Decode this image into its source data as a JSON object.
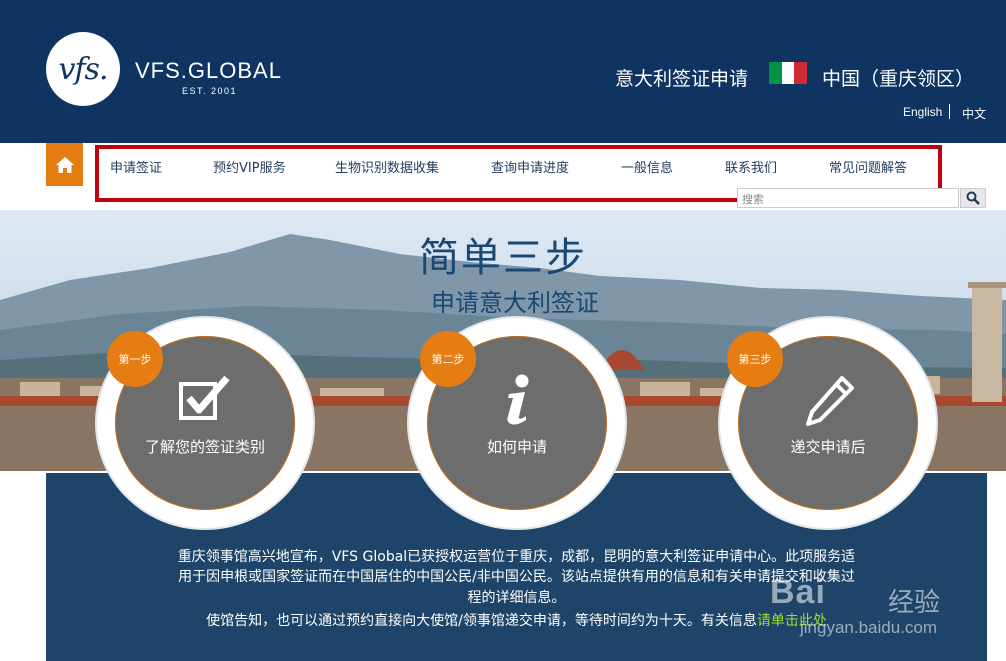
{
  "header": {
    "logo_mark": "vfs.",
    "brand_name": "VFS.GLOBAL",
    "brand_est": "EST. 2001",
    "title": "意大利签证申请",
    "region": "中国（重庆领区）",
    "flag_colors": [
      "#009246",
      "#ffffff",
      "#ce2b37"
    ],
    "lang_english": "English",
    "lang_chinese": "中文"
  },
  "nav": {
    "home_icon": "home-icon",
    "items": [
      {
        "label": "申请签证"
      },
      {
        "label": "预约VIP服务"
      },
      {
        "label": "生物识别数据收集"
      },
      {
        "label": "查询申请进度"
      },
      {
        "label": "一般信息"
      },
      {
        "label": "联系我们"
      },
      {
        "label": "常见问题解答"
      }
    ]
  },
  "search": {
    "placeholder": "搜索"
  },
  "hero": {
    "title": "简单三步",
    "subtitle": "申请意大利签证"
  },
  "steps": [
    {
      "badge": "第一步",
      "label": "了解您的签证类别",
      "icon": "checkbox-icon"
    },
    {
      "badge": "第二步",
      "label": "如何申请",
      "icon": "info-icon"
    },
    {
      "badge": "第三步",
      "label": "递交申请后",
      "icon": "pencil-icon"
    }
  ],
  "info": {
    "line1": "重庆领事馆高兴地宣布，VFS Global已获授权运营位于重庆，成都，昆明的意大利签证申请中心。此项服务适",
    "line2": "用于因申根或国家签证而在中国居住的中国公民/非中国公民。该站点提供有用的信息和有关申请提交和收集过",
    "line3": "程的详细信息。",
    "line4": "使馆告知，也可以通过预约直接向大使馆/领事馆递交申请，等待时间约为十天。有关信息",
    "link": "请单击此处"
  },
  "watermark": {
    "brand": "Bai",
    "cn": "经验",
    "url": "jingyan.baidu.com"
  },
  "colors": {
    "header_bg": "#0f3461",
    "accent_orange": "#e57d12",
    "highlight_red": "#c0000b",
    "info_bg": "#1e4469"
  }
}
